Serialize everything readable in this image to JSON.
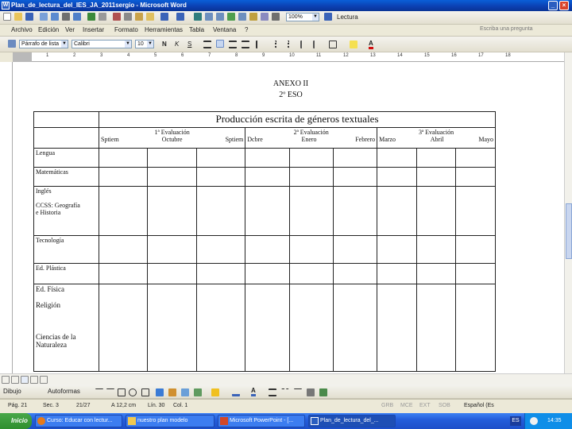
{
  "window": {
    "title": "Plan_de_lectura_del_IES_JA_2011sergio - Microsoft Word"
  },
  "menu": [
    "Archivo",
    "Edición",
    "Ver",
    "Insertar",
    "Formato",
    "Herramientas",
    "Tabla",
    "Ventana",
    "?"
  ],
  "toolbar": {
    "zoom": "100%",
    "reading": "Lectura",
    "help_placeholder": "Escriba una pregunta"
  },
  "format_bar": {
    "style": "Párrafo de lista",
    "font": "Calibri",
    "size": "10"
  },
  "ruler_numbers": [
    "1",
    "2",
    "3",
    "4",
    "5",
    "6",
    "7",
    "8",
    "9",
    "10",
    "11",
    "12",
    "13",
    "14",
    "15",
    "16",
    "17",
    "18"
  ],
  "document": {
    "anexo": "ANEXO II",
    "course": "2º ESO",
    "table_title": "Producción escrita de géneros textuales",
    "evaluations": [
      {
        "label": "1ª Evaluación",
        "months": [
          "Sptiem",
          "Octubre",
          "Sptiem"
        ]
      },
      {
        "label": "2ª Evaluación",
        "months": [
          "Dcbre",
          "Enero",
          "Febrero"
        ]
      },
      {
        "label": "3ª Evaluación",
        "months": [
          "Marzo",
          "Abril",
          "Mayo"
        ]
      }
    ],
    "subjects": [
      {
        "name": "Lengua"
      },
      {
        "name": "Matemáticas"
      },
      {
        "name": "Inglés\n\nCCSS: Geografía\ne Historia"
      },
      {
        "name": "Tecnología"
      },
      {
        "name": "Ed. Plástica"
      },
      {
        "name": "Ed. Física\n\nReligión\n\n\n\nCiencias de la\nNaturaleza"
      }
    ]
  },
  "drawing_bar": {
    "draw": "Dibujo",
    "autoshapes": "Autoformas"
  },
  "status": {
    "page": "Pág. 21",
    "section": "Sec. 3",
    "pages": "21/27",
    "position": "A 12,2 cm",
    "line": "Lín. 30",
    "col": "Col. 1",
    "grb": "GRB",
    "mce": "MCE",
    "ext": "EXT",
    "sob": "SOB",
    "lang": "Español (Es"
  },
  "taskbar": {
    "start": "Inicio",
    "tasks": [
      "Curso: Educar con lectur...",
      "nuestro plan modelo",
      "Microsoft PowerPoint - [...",
      "Plan_de_lectura_del_..."
    ],
    "lang": "ES",
    "clock": "14:35"
  }
}
